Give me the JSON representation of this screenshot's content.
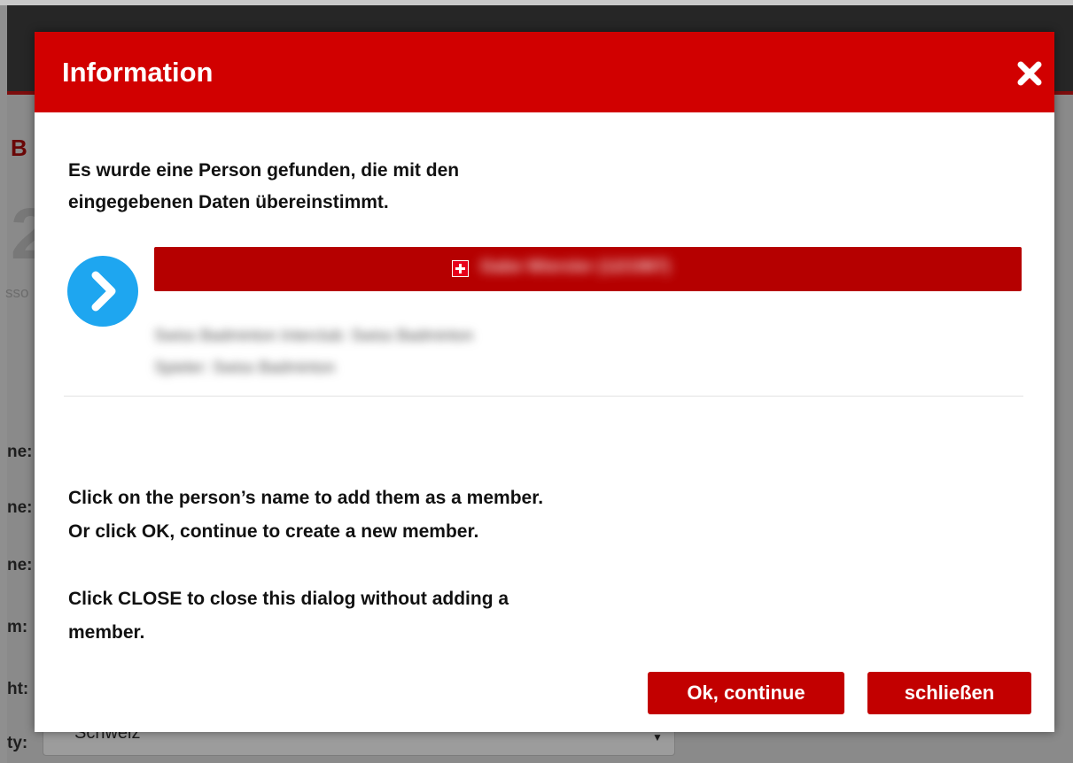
{
  "background": {
    "page_title_fragment": "B",
    "step_number": "2",
    "small_label_fragment": "sso",
    "form_labels": [
      "ne:",
      "ne:",
      "ne:",
      "m:",
      "ht:",
      "ty:"
    ],
    "country_select_value": "Schweiz"
  },
  "modal": {
    "title": "Information",
    "close_icon": "close-x-icon",
    "intro": "Es wurde eine Person gefunden, die mit den\neingegebenen Daten übereinstimmt.",
    "result": {
      "arrow_icon": "chevron-right-icon",
      "flag_icon": "swiss-flag-icon",
      "name": "Gabe Wiersler (12/1987)",
      "details": "Swiss Badminton Interclub: Swiss Badminton\nSpieler: Swiss Badminton"
    },
    "instruction_1": "Click on the person’s name to add them as a member.\nOr click OK, continue to create a new member.",
    "instruction_2": "Click CLOSE to close this dialog without adding a\nmember.",
    "buttons": {
      "ok": "Ok, continue",
      "close": "schließen"
    }
  },
  "colors": {
    "header_red": "#d10000",
    "button_red": "#c20000",
    "person_bar_red": "#b50000",
    "arrow_blue": "#1ea6f0"
  }
}
